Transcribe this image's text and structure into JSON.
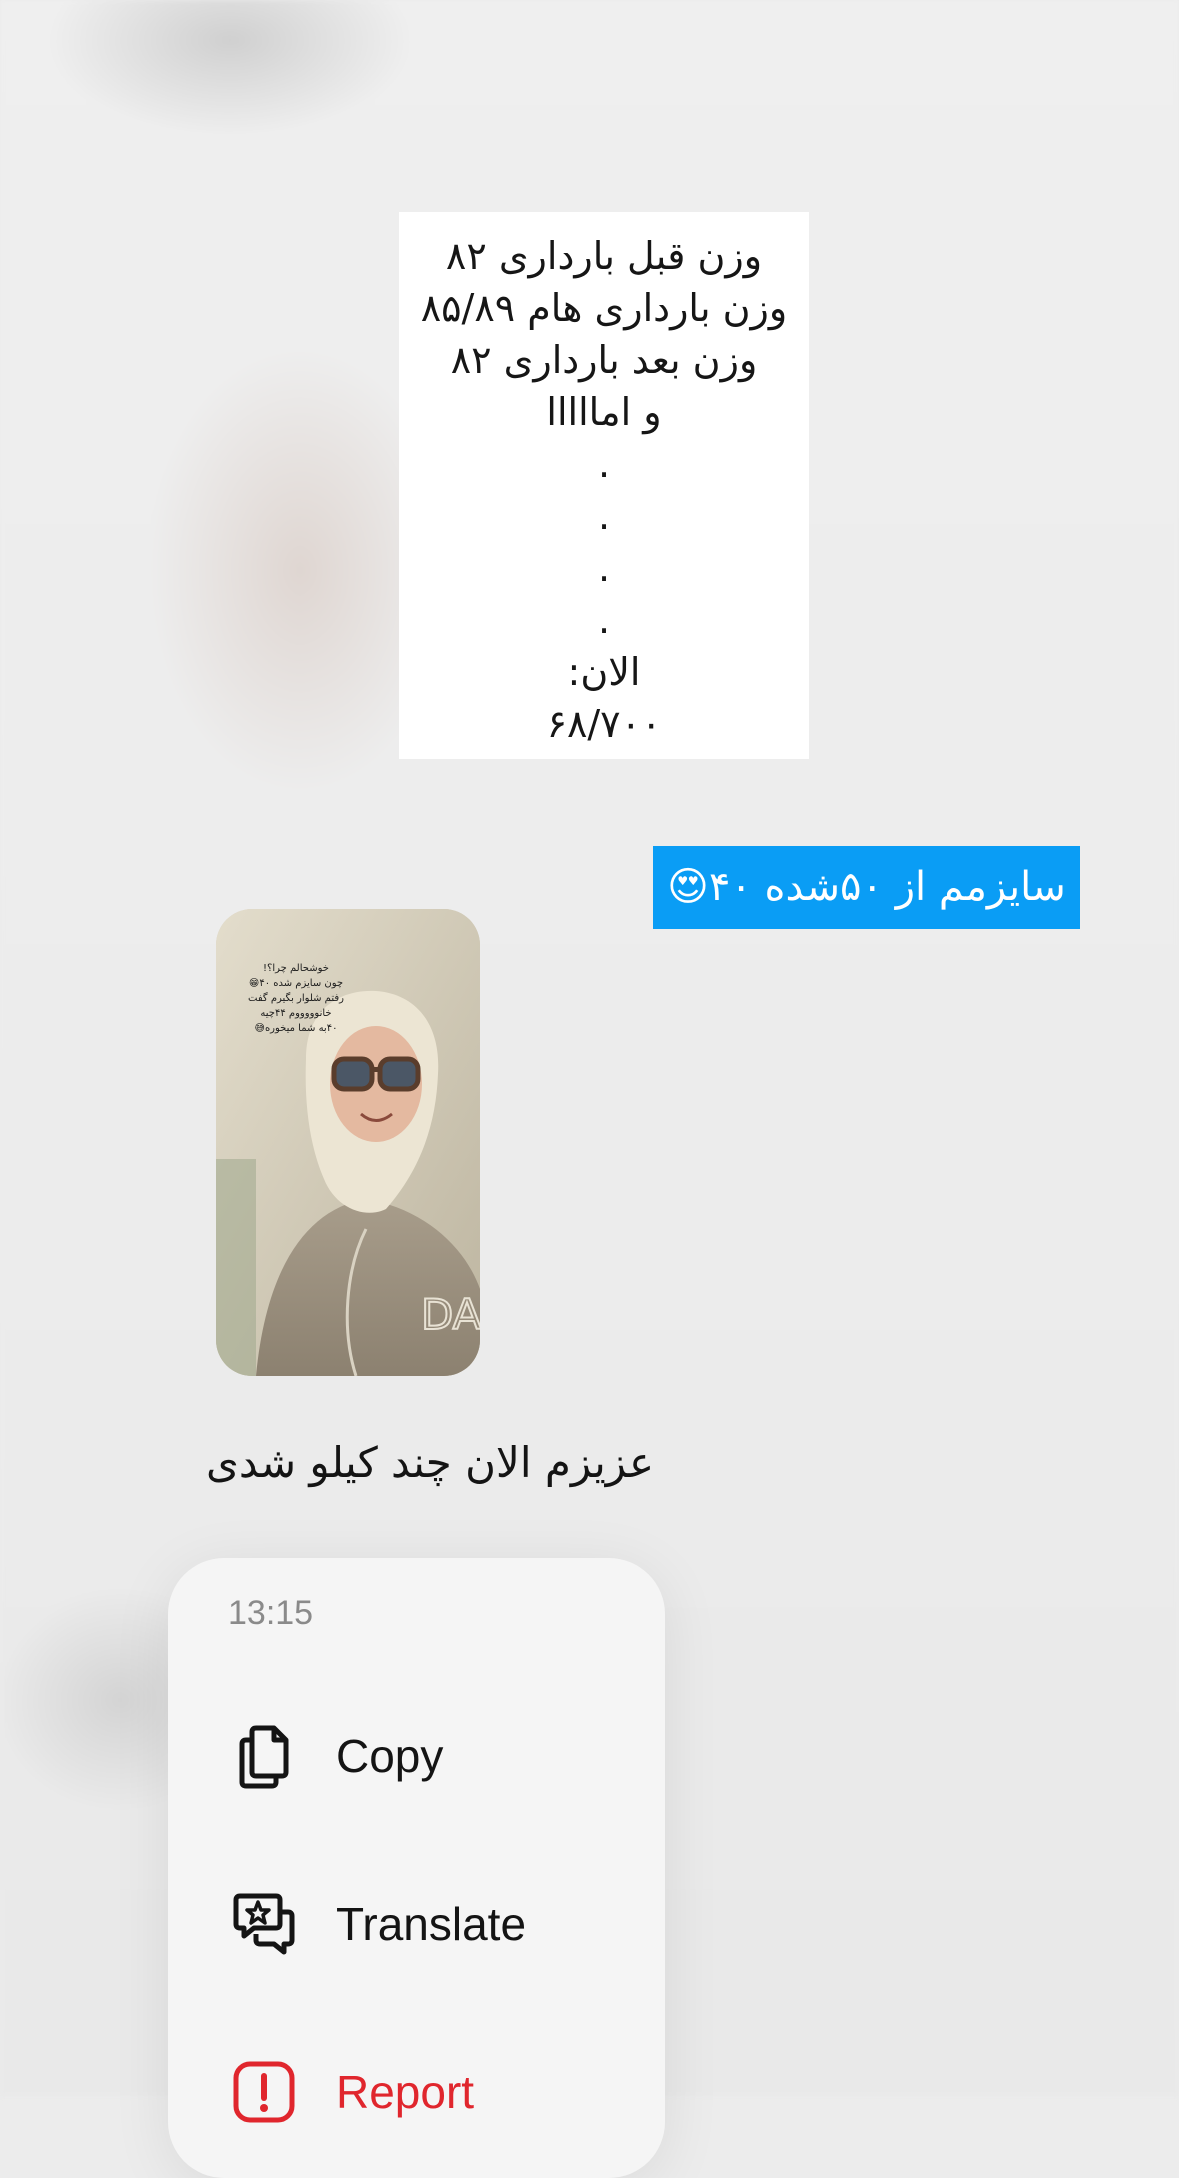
{
  "note": {
    "lines": [
      "وزن قبل بارداری ۸۲",
      "وزن بارداری هام ۸۵/۸۹",
      "وزن بعد بارداری ۸۲",
      "و امااااا",
      ".",
      ".",
      ".",
      ".",
      "الان:",
      "۶۸/۷۰۰"
    ]
  },
  "caption": {
    "text": "سایزمم از ۵۰شده ۴۰😍"
  },
  "story": {
    "overlay_lines": [
      "خوشحالم چرا؟!",
      "چون سایزم شده ۴۰😁",
      "رفتم شلوار بگیرم گفت",
      "خانوووووم ۴۴چیه",
      "۴۰به شما میخوره😅"
    ]
  },
  "reply": {
    "text": "عزیزم الان چند کیلو شدی"
  },
  "menu": {
    "time": "13:15",
    "items": [
      {
        "label": "Copy",
        "icon": "copy-icon"
      },
      {
        "label": "Translate",
        "icon": "translate-icon"
      },
      {
        "label": "Report",
        "icon": "report-icon"
      }
    ],
    "danger_color": "#e0262d"
  },
  "colors": {
    "caption_background": "#0a9df5",
    "menu_background": "#f5f5f5"
  }
}
